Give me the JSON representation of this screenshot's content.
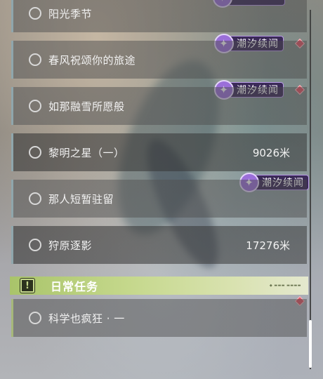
{
  "quests": [
    {
      "name": "阳光季节",
      "distance": ""
    },
    {
      "name": "春风祝颂你的旅途",
      "distance": ""
    },
    {
      "name": "如那融雪所愿般",
      "distance": ""
    },
    {
      "name": "黎明之星（一）",
      "distance": "9026米"
    },
    {
      "name": "那人短暂驻留",
      "distance": ""
    },
    {
      "name": "狩原逐影",
      "distance": "17276米"
    }
  ],
  "tags": [
    {
      "label": "潮汐续闻"
    },
    {
      "label": "潮汐续闻"
    },
    {
      "label": "潮汐续闻"
    }
  ],
  "daily_section": {
    "title": "日常任务",
    "icon": "exclamation-icon",
    "quest": {
      "name": "科学也疯狂 · 一"
    }
  },
  "icons": {
    "tag": "sparkle-icon",
    "marker": "red-diamond-marker",
    "quest": "circle-outline-icon"
  },
  "colors": {
    "tag_bg": "#3b2a58",
    "tag_border": "#b99be8",
    "marker": "#e05666",
    "daily_accent": "#a9c46a",
    "row_accent": "#8fa6ac"
  }
}
